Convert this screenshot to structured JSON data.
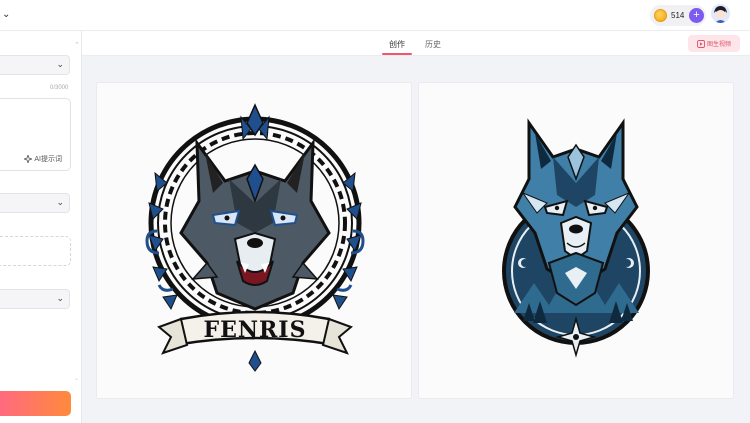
{
  "header": {
    "credits": "514",
    "add_symbol": "+"
  },
  "sidebar": {
    "char_count": "0/3000",
    "ai_hint_label": "AI提示词"
  },
  "tabs": [
    {
      "label": "创作",
      "active": true
    },
    {
      "label": "历史",
      "active": false
    }
  ],
  "actions": {
    "image_to_video_label": "图生视频"
  },
  "gallery": {
    "images": [
      {
        "banner_text": "FENRIS",
        "icon": "wolf-emblem-fenris"
      },
      {
        "banner_text": "",
        "icon": "wolf-emblem-blue"
      }
    ]
  },
  "colors": {
    "accent": "#f0566c",
    "credits_plus": "#7c5cf0",
    "generate_gradient_start": "#ff6a7f",
    "generate_gradient_end": "#ff8a3c",
    "wolf_blue": "#1f4f8c",
    "wolf_gray": "#4d5a66"
  }
}
